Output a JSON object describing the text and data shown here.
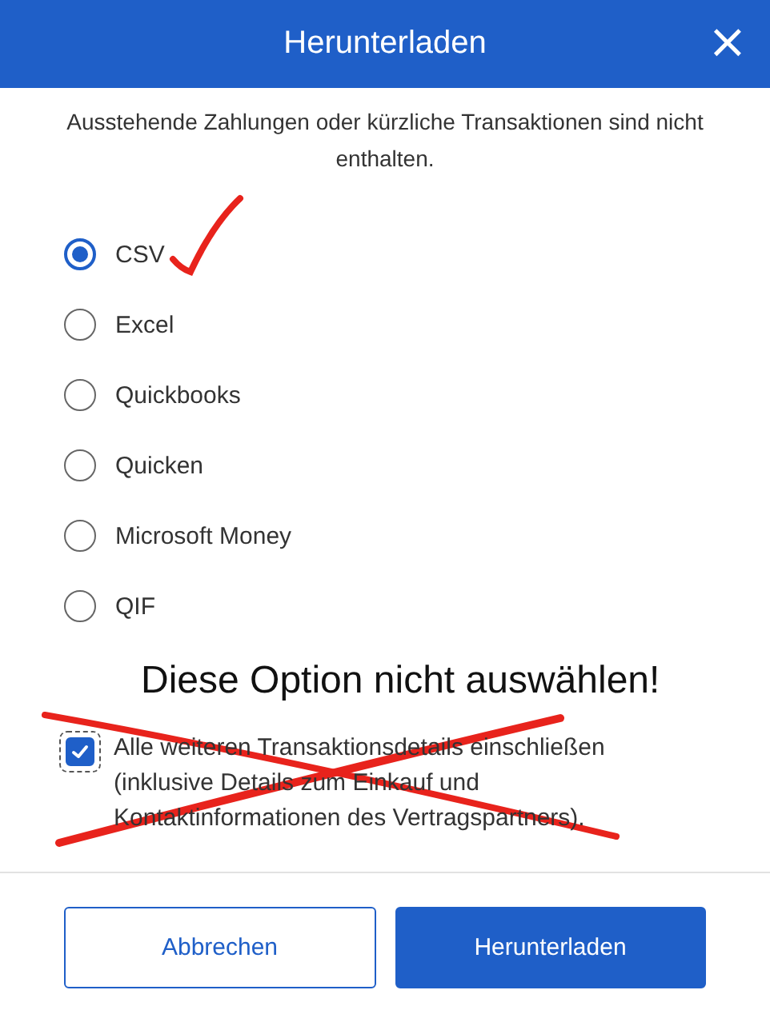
{
  "dialog": {
    "title": "Herunterladen",
    "close": "×"
  },
  "note": "Ausstehende Zahlungen oder kürzliche Transaktionen sind nicht enthalten.",
  "formats": [
    {
      "label": "CSV",
      "selected": true
    },
    {
      "label": "Excel",
      "selected": false
    },
    {
      "label": "Quickbooks",
      "selected": false
    },
    {
      "label": "Quicken",
      "selected": false
    },
    {
      "label": "Microsoft Money",
      "selected": false
    },
    {
      "label": "QIF",
      "selected": false
    }
  ],
  "annotation": "Diese Option nicht auswählen!",
  "include_details": {
    "label": "Alle weiteren Transaktionsdetails einschließen (inklusive Details zum Einkauf und Kontaktinformationen des Vertragspartners).",
    "checked": true
  },
  "buttons": [
    {
      "label": "Abbrechen",
      "kind": "secondary"
    },
    {
      "label": "Herunterladen",
      "kind": "primary"
    }
  ]
}
